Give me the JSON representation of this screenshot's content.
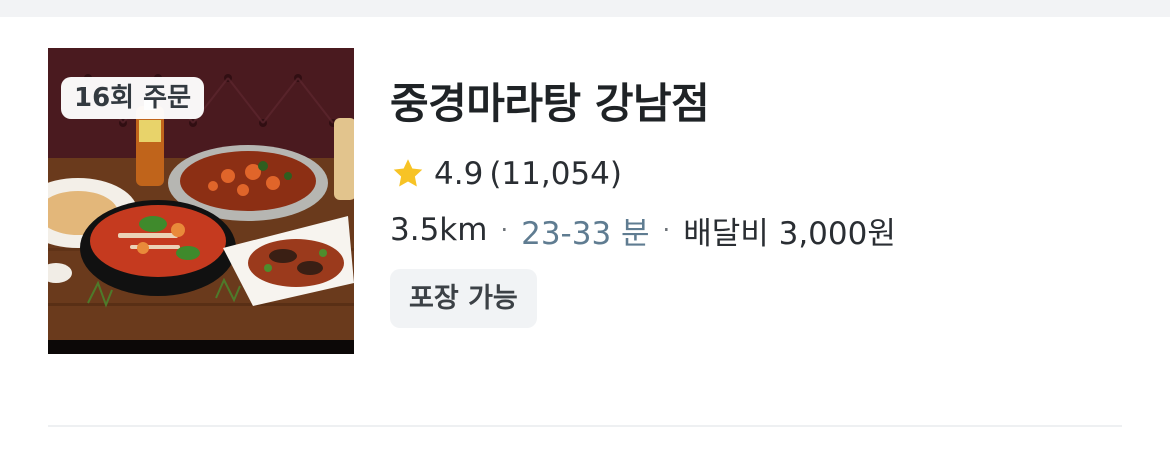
{
  "store": {
    "name": "중경마라탕 강남점",
    "order_badge": "16회 주문",
    "rating": "4.9",
    "review_count": "(11,054)",
    "distance": "3.5km",
    "delivery_time": "23-33 분",
    "delivery_fee": "배달비 3,000원",
    "separator": "·",
    "tag": "포장 가능"
  },
  "icons": {
    "rating": "star-icon"
  },
  "colors": {
    "star": "#f7c325",
    "eta": "#5f7c91",
    "title": "#1f2326",
    "tag_bg": "#f1f3f5"
  }
}
